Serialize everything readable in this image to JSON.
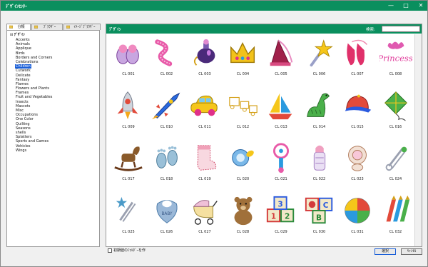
{
  "window": {
    "title": "ﾃﾞｻﾞｲﾝｾﾝﾀｰ",
    "minimize": "—",
    "maximize": "□",
    "close": "✕"
  },
  "tabs": [
    {
      "label": "分類",
      "icon": "folder-icon"
    },
    {
      "label": "ﾌﾞﾗｳｻﾞｰ",
      "icon": "folder-icon"
    },
    {
      "label": "ｲﾒｰｼﾞﾌﾞﾗｳｻﾞｰ",
      "icon": "folder-icon"
    }
  ],
  "tree": {
    "root": "ﾃﾞｻﾞｲﾝ",
    "items": [
      "Accents",
      "Animals",
      "Applique",
      "Birds",
      "Borders and Corners",
      "Celebrations",
      "Children",
      "Cutwork",
      "Delicate",
      "Fantasy",
      "Flames",
      "Flowers and Plants",
      "Frames",
      "Fruit and Vegetables",
      "Insects",
      "Mascots",
      "Misc",
      "Occupations",
      "One Color",
      "Quilting",
      "Seasons",
      "shells",
      "Splatters",
      "Sports and Games",
      "Vehicles",
      "Wings"
    ],
    "selected_index": 6
  },
  "panel": {
    "header": "ﾃﾞｻﾞｲﾝ",
    "search_label": "検索:",
    "search_value": ""
  },
  "designs": [
    {
      "code": "CL 001",
      "icon": "slippers-icon"
    },
    {
      "code": "CL 002",
      "icon": "feather-boa-icon"
    },
    {
      "code": "CL 003",
      "icon": "perfume-bottle-icon"
    },
    {
      "code": "CL 004",
      "icon": "crown-icon"
    },
    {
      "code": "CL 005",
      "icon": "princess-hat-icon"
    },
    {
      "code": "CL 006",
      "icon": "magic-wand-icon"
    },
    {
      "code": "CL 007",
      "icon": "ballet-shoes-icon"
    },
    {
      "code": "CL 008",
      "icon": "princess-text-icon"
    },
    {
      "code": "CL 009",
      "icon": "rocket-icon"
    },
    {
      "code": "CL 010",
      "icon": "rocket-ship-icon"
    },
    {
      "code": "CL 011",
      "icon": "toy-car-icon"
    },
    {
      "code": "CL 012",
      "icon": "train-outline-icon"
    },
    {
      "code": "CL 013",
      "icon": "sailboat-icon"
    },
    {
      "code": "CL 014",
      "icon": "dinosaur-icon"
    },
    {
      "code": "CL 015",
      "icon": "baseball-cap-icon"
    },
    {
      "code": "CL 016",
      "icon": "kite-icon"
    },
    {
      "code": "CL 017",
      "icon": "rocking-horse-icon"
    },
    {
      "code": "CL 018",
      "icon": "footprints-icon"
    },
    {
      "code": "CL 019",
      "icon": "baby-sock-icon"
    },
    {
      "code": "CL 020",
      "icon": "pacifier-icon"
    },
    {
      "code": "CL 021",
      "icon": "rattle-icon"
    },
    {
      "code": "CL 022",
      "icon": "baby-bottle-icon"
    },
    {
      "code": "CL 023",
      "icon": "pacifier-outline-icon"
    },
    {
      "code": "CL 024",
      "icon": "safety-pin-icon"
    },
    {
      "code": "CL 025",
      "icon": "safety-pin-star-icon"
    },
    {
      "code": "CL 026",
      "icon": "baby-bib-icon"
    },
    {
      "code": "CL 027",
      "icon": "stroller-icon"
    },
    {
      "code": "CL 028",
      "icon": "teddy-bear-icon"
    },
    {
      "code": "CL 029",
      "icon": "blocks-123-icon"
    },
    {
      "code": "CL 030",
      "icon": "blocks-abc-icon"
    },
    {
      "code": "CL 031",
      "icon": "beach-ball-icon"
    },
    {
      "code": "CL 032",
      "icon": "crayons-icon"
    }
  ],
  "bottom": {
    "checkbox_label": "初期値のﾌｫﾙﾀﾞｰを作",
    "checkbox_checked": false,
    "ok_label": "選択",
    "cancel_label": "ｷｬﾝｾﾙ"
  },
  "colors": {
    "accent": "#0a8f5e",
    "selection": "#1a5fd8"
  }
}
